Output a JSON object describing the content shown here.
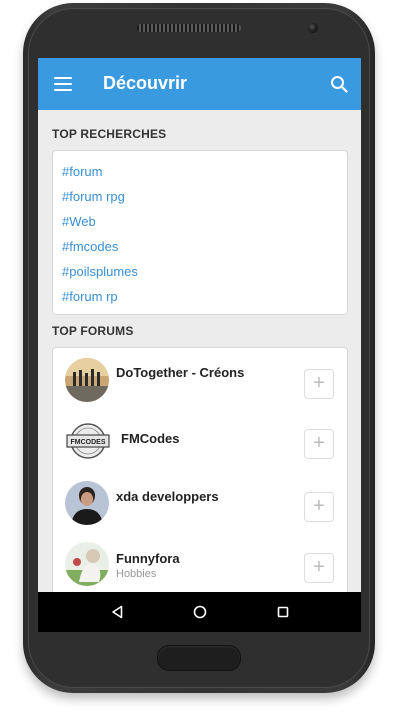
{
  "appbar": {
    "title": "Découvrir",
    "menu_icon": "menu-icon",
    "search_icon": "search-icon",
    "color": "#3a9ae0"
  },
  "top_searches": {
    "heading": "TOP RECHERCHES",
    "tags": [
      "#forum",
      "#forum rpg",
      "#Web",
      "#fmcodes",
      "#poilsplumes",
      "#forum rp"
    ]
  },
  "top_forums": {
    "heading": "TOP FORUMS",
    "items": [
      {
        "name": "DoTogether - Créons",
        "category": "",
        "add_label": "+"
      },
      {
        "name": "FMCodes",
        "category": "",
        "avatar_text": "FMCODES",
        "add_label": "+"
      },
      {
        "name": "xda developpers",
        "category": "",
        "add_label": "+"
      },
      {
        "name": "Funnyfora",
        "category": "Hobbies",
        "add_label": "+"
      }
    ]
  },
  "navbar": {
    "back_icon": "back-triangle-icon",
    "home_icon": "home-circle-icon",
    "recents_icon": "recents-square-icon"
  }
}
